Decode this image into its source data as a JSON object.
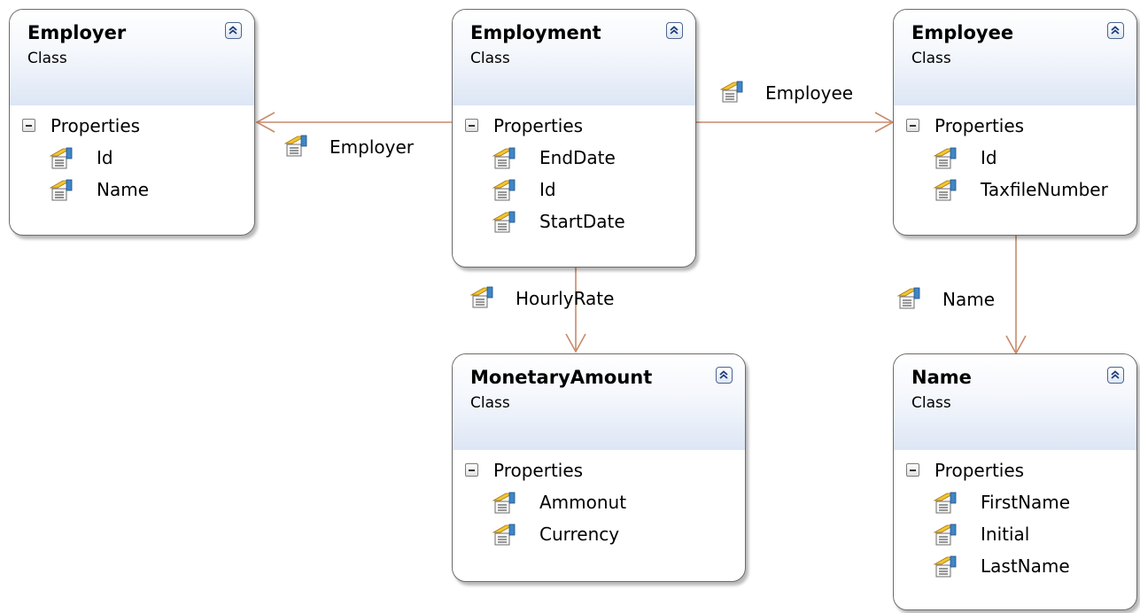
{
  "classes": [
    {
      "id": "employer",
      "name": "Employer",
      "kind": "Class",
      "compartment": "Properties",
      "properties": [
        "Id",
        "Name"
      ]
    },
    {
      "id": "employment",
      "name": "Employment",
      "kind": "Class",
      "compartment": "Properties",
      "properties": [
        "EndDate",
        "Id",
        "StartDate"
      ]
    },
    {
      "id": "employee",
      "name": "Employee",
      "kind": "Class",
      "compartment": "Properties",
      "properties": [
        "Id",
        "TaxfileNumber"
      ]
    },
    {
      "id": "monetary-amount",
      "name": "MonetaryAmount",
      "kind": "Class",
      "compartment": "Properties",
      "properties": [
        "Ammonut",
        "Currency"
      ]
    },
    {
      "id": "name",
      "name": "Name",
      "kind": "Class",
      "compartment": "Properties",
      "properties": [
        "FirstName",
        "Initial",
        "LastName"
      ]
    }
  ],
  "associations": [
    {
      "id": "employer",
      "label": "Employer",
      "from": "Employment",
      "to": "Employer",
      "icon": "property-icon"
    },
    {
      "id": "employee",
      "label": "Employee",
      "from": "Employment",
      "to": "Employee",
      "icon": "property-icon"
    },
    {
      "id": "hourly-rate",
      "label": "HourlyRate",
      "from": "Employment",
      "to": "MonetaryAmount",
      "icon": "property-icon"
    },
    {
      "id": "name",
      "label": "Name",
      "from": "Employee",
      "to": "Name",
      "icon": "property-icon"
    }
  ],
  "colors": {
    "connector": "#c88a6a",
    "border": "#6b6b6b",
    "header_gradient_end": "#dde6f5"
  }
}
